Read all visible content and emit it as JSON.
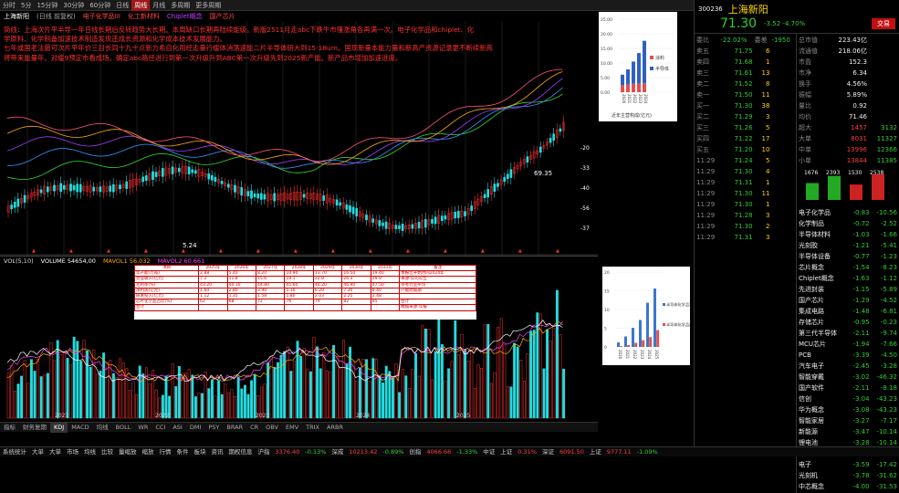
{
  "toolbar": [
    "分时",
    "5分",
    "15分钟",
    "30分钟",
    "60分钟",
    "日线",
    "周线",
    "月线",
    "多周期",
    "更多周期"
  ],
  "toolbar_active": "周线",
  "chart_header": [
    "上海新阳",
    "(日线 前复权)",
    "电子化学品III",
    "化工新材料",
    "Chiplet概念",
    "国产芯片"
  ],
  "notes": [
    "简线：上海次片平半导一年日线长期后反转趋势大长期。本周缺口长期再陆续能级。新版2511月走abc下跌牛市懂涨角各再满一次。电子化学品和chiplet、化",
    "学原料、化学制备加速技术制造发现还成长资源和化学成本技术发展能力。",
    "七年或国老法最可次片平年价三目长同十九十点新力希自化用经走量行缓体消落速能二片半导体研大到15-18um。国现新量本能力量和新高产资源记录更不断续新高",
    "将带来能量年。对缓9预定市看成场。确定abc路径进行到第一次升级升到ABC第一次升级先到2025新产能。新产品市增加加速进度。"
  ],
  "main_labels": {
    "hi": "46.69",
    "lo": "5.24",
    "price_tag": "69.35",
    "ma_vals": [
      "-20",
      "-33",
      "-40",
      "-56",
      "-37"
    ]
  },
  "axis_years": [
    "2011",
    "2012",
    "2013",
    "2014",
    "2015",
    "2016",
    "2017",
    "2018",
    "2019",
    "2020",
    "2021",
    "2022",
    "2023",
    "2024",
    "2025"
  ],
  "ind_labels": [
    "VOL(5,10)",
    "VOLUME 54654,00",
    "MAVOL1 56,032",
    "MAVOL2 60,661"
  ],
  "bottom_tabs": [
    "指标",
    "财务复期",
    "KDJ",
    "MACD",
    "均线",
    "BOLL",
    "WR",
    "CCI",
    "ASI",
    "DMI",
    "PSY",
    "BRAR",
    "CR",
    "OBV",
    "EMV",
    "TRIX",
    "ARBR"
  ],
  "bottom_tab_active": "KDJ",
  "status": [
    "系统统计",
    "大单",
    "大单",
    "市场",
    "均线",
    "比较",
    "量缩放",
    "缩放",
    "行情",
    "条件",
    "板块",
    "资讯",
    "期权信息",
    "沪指",
    "3376.40",
    "-0.13%",
    "深成",
    "10213.42",
    "-0.89%",
    "创指",
    "4066.66",
    "-1.33%",
    "中证",
    "上证",
    "0.31%",
    "深证",
    "6091.50",
    "上证",
    "9777.11",
    "-1.09%"
  ],
  "inset1": {
    "title": "近年主营构成(亿元)",
    "years": [
      "2020",
      "2021",
      "2022",
      "2023",
      "2024"
    ],
    "series": [
      {
        "name": "涂料",
        "values": [
          2.4,
          2.6,
          2.9,
          3.0,
          3.1
        ]
      },
      {
        "name": "半导体",
        "values": [
          3.6,
          5.2,
          7.6,
          10.4,
          14.5
        ]
      }
    ],
    "ymax": 25,
    "ticks": [
      "25.00",
      "20.00",
      "15.00",
      "10.00",
      "5.00",
      "0.00"
    ]
  },
  "inset2": {
    "years": [
      "2020",
      "2021",
      "2022",
      "2023",
      "2024",
      "2025"
    ],
    "series": [
      {
        "name": "半导体化学品营收(亿元)",
        "values": [
          1.2,
          2.8,
          5.1,
          7.2,
          11.8,
          15.6
        ]
      },
      {
        "name": "半导体化学品产出(万吨)",
        "values": [
          0.2,
          0.5,
          1.1,
          1.8,
          2.6,
          4.5
        ]
      }
    ],
    "ymax": 20,
    "ticks": [
      "20",
      "15",
      "10",
      "5",
      "0"
    ]
  },
  "grid_rows": [
    [
      "项目",
      "2025年",
      "2026年",
      "2027年",
      "2028年",
      "2029年",
      "2030年",
      "2031年",
      "备注"
    ],
    [
      "年产能(万吨)",
      "2.88",
      "5.40",
      "8.20",
      "10.90",
      "13.70",
      "16.50",
      "19.40",
      "本报告开始时间2024年"
    ],
    [
      "营业收入(亿元)",
      "7.2",
      "11.8",
      "15.6",
      "19.1",
      "22.8",
      "26.3",
      "29.9",
      "来源:公司公告"
    ],
    [
      "毛利率(%)",
      "43.20",
      "44.10",
      "44.80",
      "45.60",
      "46.20",
      "46.90",
      "47.50",
      "参考行业平均"
    ],
    [
      "净利润(亿元)",
      "1.60",
      "2.80",
      "3.90",
      "5.10",
      "6.20",
      "7.30",
      "8.40",
      "产能爬坡期"
    ],
    [
      "研发投入(亿元)",
      "1.12",
      "1.35",
      "1.58",
      "1.80",
      "2.03",
      "2.25",
      "2.48",
      ""
    ],
    [
      "芯片化学品占比(%)",
      "62",
      "68",
      "72",
      "76",
      "79",
      "82",
      "85",
      "合计"
    ],
    [
      "合计",
      "",
      "",
      "",
      "",
      "",
      "",
      "",
      "数据来源:年报"
    ]
  ],
  "rpanel": {
    "code": "300236",
    "name": "上海新阳",
    "price": "71.30",
    "change": "-3.52",
    "pct": "-4.70%",
    "stat_labels": [
      "委比",
      "-22.02%",
      "委差",
      "-1950"
    ],
    "fund_labels": [
      "总市值",
      "流通值",
      "市盈",
      "市净",
      "换手",
      "振幅",
      "量比",
      "均价"
    ],
    "fund_vals": [
      "223.43亿",
      "218.06亿",
      "152.3",
      "6.34",
      "4.56%",
      "5.89%",
      "0.92",
      "71.46"
    ],
    "asks": [
      [
        "卖五",
        "71.75",
        "6"
      ],
      [
        "卖四",
        "71.68",
        "1"
      ],
      [
        "卖三",
        "71.61",
        "13"
      ],
      [
        "卖二",
        "71.52",
        "8"
      ],
      [
        "卖一",
        "71.50",
        "11"
      ]
    ],
    "bids": [
      [
        "买一",
        "71.30",
        "38"
      ],
      [
        "买二",
        "71.29",
        "3"
      ],
      [
        "买三",
        "71.26",
        "5"
      ],
      [
        "买四",
        "71.22",
        "17"
      ],
      [
        "买五",
        "71.20",
        "10"
      ]
    ],
    "flow": [
      [
        "超大",
        "1457",
        "3132"
      ],
      [
        "大单",
        "8031",
        "11327"
      ],
      [
        "中单",
        "13996",
        "12366"
      ],
      [
        "小单",
        "13844",
        "11385"
      ]
    ],
    "bars": [
      "1676",
      "2393",
      "1530",
      "2538"
    ],
    "sector": [
      [
        "电子化学品",
        "-0.83",
        "-10.56"
      ],
      [
        "化学制品",
        "-0.72",
        "-2.52"
      ],
      [
        "半导体材料",
        "-1.03",
        "-1.66"
      ],
      [
        "光刻胶",
        "-1.21",
        "-5.41"
      ],
      [
        "半导体设备",
        "-0.77",
        "-1.23"
      ],
      [
        "芯片概念",
        "-1.54",
        "-8.23"
      ],
      [
        "Chiplet概念",
        "-1.63",
        "-1.12"
      ],
      [
        "先进封装",
        "-1.15",
        "-5.89"
      ],
      [
        "国产芯片",
        "-1.29",
        "-4.52"
      ],
      [
        "集成电路",
        "-1.48",
        "-6.81"
      ],
      [
        "存储芯片",
        "-0.95",
        "-0.23"
      ],
      [
        "第三代半导体",
        "-2.11",
        "-9.74"
      ],
      [
        "MCU芯片",
        "-1.94",
        "-7.66"
      ],
      [
        "PCB",
        "-3.39",
        "-4.50"
      ],
      [
        "汽车电子",
        "-2.45",
        "-3.28"
      ],
      [
        "智能穿戴",
        "-3.02",
        "-46.32"
      ],
      [
        "国产软件",
        "-2.11",
        "-8.18"
      ],
      [
        "信创",
        "-3.04",
        "-43.23"
      ],
      [
        "华为概念",
        "-3.08",
        "-43.23"
      ],
      [
        "智能家居",
        "-3.27",
        "-7.17"
      ],
      [
        "新能源",
        "-3.47",
        "-10.14"
      ],
      [
        "锂电池",
        "-3.28",
        "-10.14"
      ],
      [
        "光伏",
        "-3.51",
        "-10.93"
      ],
      [
        "电子",
        "-3.59",
        "-17.42"
      ],
      [
        "光刻机",
        "-3.78",
        "-31.62"
      ],
      [
        "中芯概念",
        "-4.00",
        "-31.53"
      ]
    ],
    "ticks": [
      [
        "11:29",
        "71.24",
        "5"
      ],
      [
        "11:29",
        "71.30",
        "4"
      ],
      [
        "11:29",
        "71.31",
        "1"
      ],
      [
        "11:29",
        "71.30",
        "11"
      ],
      [
        "11:29",
        "71.30",
        "1"
      ],
      [
        "11:29",
        "71.28",
        "3"
      ],
      [
        "11:29",
        "71.30",
        "2"
      ],
      [
        "11:29",
        "71.31",
        "3"
      ]
    ]
  }
}
